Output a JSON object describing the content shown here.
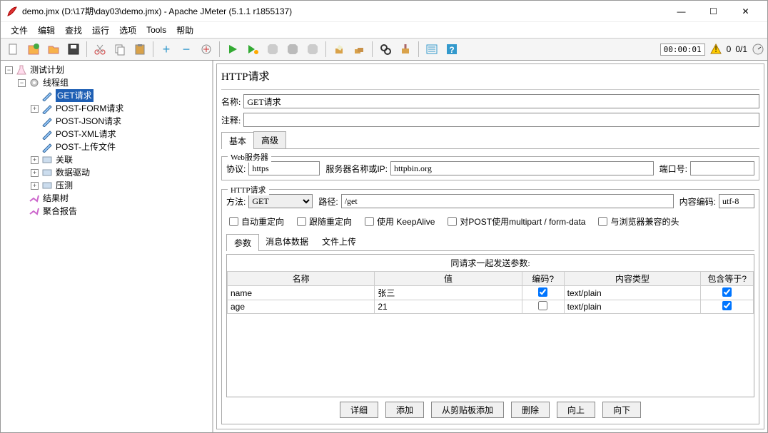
{
  "window": {
    "title": "demo.jmx (D:\\17期\\day03\\demo.jmx) - Apache JMeter (5.1.1 r1855137)"
  },
  "menu": {
    "file": "文件",
    "edit": "编辑",
    "search": "查找",
    "run": "运行",
    "options": "选项",
    "tools": "Tools",
    "help": "帮助"
  },
  "toolbar": {
    "timer": "00:00:01",
    "counter": "0/1"
  },
  "tree": {
    "root": "测试计划",
    "threadGroup": "线程组",
    "items": [
      "GET请求",
      "POST-FORM请求",
      "POST-JSON请求",
      "POST-XML请求",
      "POST-上传文件",
      "关联",
      "数据驱动",
      "压测"
    ],
    "resultTree": "结果树",
    "aggregate": "聚合报告"
  },
  "panel": {
    "title": "HTTP请求",
    "nameLabel": "名称:",
    "nameValue": "GET请求",
    "commentLabel": "注释:",
    "commentValue": "",
    "tabs": {
      "basic": "基本",
      "advanced": "高级"
    },
    "webServer": {
      "legend": "Web服务器",
      "protocolLabel": "协议:",
      "protocol": "https",
      "serverLabel": "服务器名称或IP:",
      "server": "httpbin.org",
      "portLabel": "端口号:",
      "port": ""
    },
    "httpReq": {
      "legend": "HTTP请求",
      "methodLabel": "方法:",
      "method": "GET",
      "pathLabel": "路径:",
      "path": "/get",
      "encodingLabel": "内容编码:",
      "encoding": "utf-8",
      "checks": {
        "autoRedirect": "自动重定向",
        "followRedirect": "跟随重定向",
        "keepAlive": "使用 KeepAlive",
        "multipart": "对POST使用multipart / form-data",
        "browserHeaders": "与浏览器兼容的头"
      }
    },
    "paramTabs": {
      "params": "参数",
      "body": "消息体数据",
      "file": "文件上传"
    },
    "paramsTitle": "同请求一起发送参数:",
    "columns": {
      "name": "名称",
      "value": "值",
      "encode": "编码?",
      "contentType": "内容类型",
      "include": "包含等于?"
    },
    "rows": [
      {
        "name": "name",
        "value": "张三",
        "encode": true,
        "contentType": "text/plain",
        "include": true
      },
      {
        "name": "age",
        "value": "21",
        "encode": false,
        "contentType": "text/plain",
        "include": true
      }
    ],
    "buttons": {
      "detail": "详细",
      "add": "添加",
      "paste": "从剪贴板添加",
      "delete": "删除",
      "up": "向上",
      "down": "向下"
    }
  }
}
